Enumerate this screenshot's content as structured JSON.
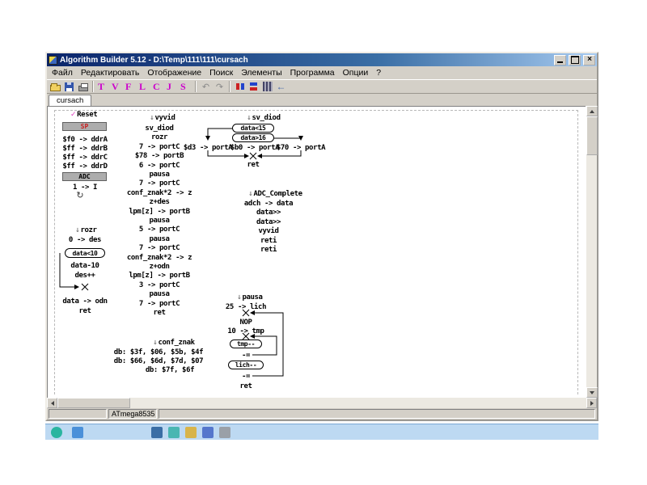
{
  "window": {
    "title": "Algorithm Builder 5.12 - D:\\Temp\\111\\111\\cursach"
  },
  "icons": {
    "check": "✓",
    "label_arrow": "↓",
    "loop": "↻",
    "undo": "↶",
    "redo": "↷",
    "back": "←",
    "close": "×"
  },
  "menu": [
    "Файл",
    "Редактировать",
    "Отображение",
    "Поиск",
    "Элементы",
    "Программа",
    "Опции",
    "?"
  ],
  "toolbar_letters": [
    "T",
    "V",
    "F",
    "L",
    "C",
    "J",
    "S"
  ],
  "tab": "cursach",
  "status": {
    "device": "ATmega8535"
  },
  "diagram": {
    "reset": {
      "label": "Reset",
      "sp_box": "SP",
      "init_lines": [
        "$f0 -> ddrA",
        "$ff -> ddrB",
        "$ff -> ddrC",
        "$ff -> ddrD"
      ],
      "adc_box": "ADC",
      "int_enable": "1 -> I"
    },
    "rozr": {
      "label": "rozr",
      "line1": "0 -> des",
      "cond": "data<10",
      "body": [
        "data-10",
        "des++"
      ],
      "line2": "data -> odn",
      "ret": "ret"
    },
    "vyvid": {
      "label": "vyvid",
      "lines": [
        "sv_diod",
        "rozr",
        "7 -> portC",
        "$78 -> portB",
        "6 -> portC",
        "pausa",
        "7 -> portC",
        "conf_znak*2 -> z",
        "z+des",
        "lpm[z] -> portB",
        "pausa",
        "5 -> portC",
        "pausa",
        "7 -> portC",
        "conf_znak*2 -> z",
        "z+odn",
        "lpm[z] -> portB",
        "3 -> portC",
        "pausa",
        "7 -> portC",
        "ret"
      ]
    },
    "conf_znak": {
      "label": "conf_znak",
      "lines": [
        "db: $3f, $06, $5b, $4f",
        "db: $66, $6d, $7d, $07",
        "db: $7f, $6f"
      ]
    },
    "sv_diod": {
      "label": "sv_diod",
      "cond1": "data<15",
      "cond2": "data>16",
      "branch_left": "$d3 -> portA",
      "branch_mid": "$b0 -> portA",
      "branch_right": "$70 -> portA",
      "ret": "ret"
    },
    "adc_complete": {
      "label": "ADC_Complete",
      "lines": [
        "adch -> data",
        "data>>",
        "data>>",
        "vyvid",
        "reti",
        "reti"
      ]
    },
    "pausa": {
      "label": "pausa",
      "line1": "25 -> lich",
      "nop": "NOP",
      "line2": "10 -> tmp",
      "loop1": "tmp--",
      "br1": "-=",
      "loop2": "lich--",
      "br2": "-=",
      "ret": "ret"
    }
  }
}
